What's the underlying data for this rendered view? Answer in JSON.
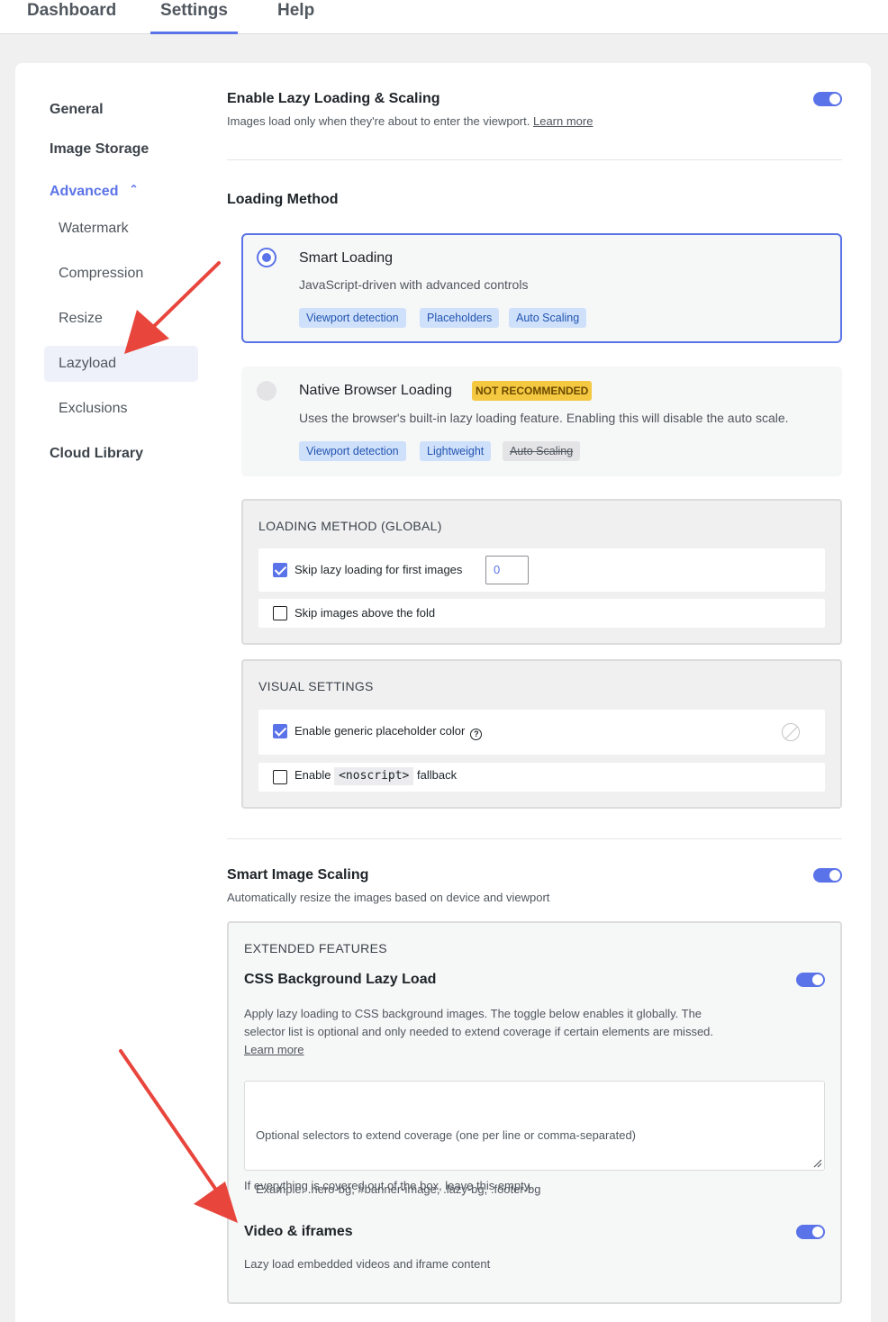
{
  "tabs": [
    "Dashboard",
    "Settings",
    "Help"
  ],
  "sidebar": {
    "items": [
      "General",
      "Image Storage",
      "Advanced"
    ],
    "sub_items": [
      "Watermark",
      "Compression",
      "Resize",
      "Lazyload",
      "Exclusions"
    ],
    "bottom_item": "Cloud Library",
    "active_sub": "Lazyload"
  },
  "lazy": {
    "title": "Enable Lazy Loading & Scaling",
    "desc": "Images load only when they're about to enter the viewport.",
    "learn_more": "Learn more",
    "enabled": true
  },
  "loading_method": {
    "title": "Loading Method",
    "smart": {
      "title": "Smart Loading",
      "desc": "JavaScript-driven with advanced controls",
      "tags": [
        "Viewport detection",
        "Placeholders",
        "Auto Scaling"
      ],
      "selected": true
    },
    "native": {
      "title": "Native Browser Loading",
      "badge": "NOT RECOMMENDED",
      "desc": "Uses the browser's built-in lazy loading feature. Enabling this will disable the auto scale.",
      "tags": [
        "Viewport detection",
        "Lightweight",
        "Auto Scaling"
      ],
      "selected": false
    }
  },
  "global_group": {
    "title": "LOADING METHOD (GLOBAL)",
    "skip_first_label": "Skip lazy loading for first images",
    "skip_first_value": "0",
    "skip_first_checked": true,
    "skip_fold_label": "Skip images above the fold",
    "skip_fold_checked": false
  },
  "visual_group": {
    "title": "VISUAL SETTINGS",
    "placeholder_label": "Enable generic placeholder color",
    "placeholder_checked": true,
    "noscript_prefix": "Enable",
    "noscript_code": "<noscript>",
    "noscript_suffix": "fallback",
    "noscript_checked": false
  },
  "scaling": {
    "title": "Smart Image Scaling",
    "desc": "Automatically resize the images based on device and viewport",
    "enabled": true
  },
  "extended": {
    "title": "EXTENDED FEATURES",
    "css_bg": {
      "title": "CSS Background Lazy Load",
      "desc_line1": "Apply lazy loading to CSS background images. The toggle below enables it globally. The",
      "desc_line2": "selector list is optional and only needed to extend coverage if certain elements are missed.",
      "learn_more": "Learn more",
      "placeholder_line1": "Optional selectors to extend coverage (one per line or comma-separated)",
      "placeholder_line2": "Example: .hero-bg, #banner-image, .lazy-bg, .footer-bg",
      "hint": "If everything is covered out of the box, leave this empty.",
      "enabled": true
    },
    "video": {
      "title": "Video & iframes",
      "desc": "Lazy load embedded videos and iframe content",
      "enabled": true
    }
  },
  "colors": {
    "accent": "#5b73e8",
    "arrow": "#e8453c",
    "badge": "#f5c842"
  }
}
